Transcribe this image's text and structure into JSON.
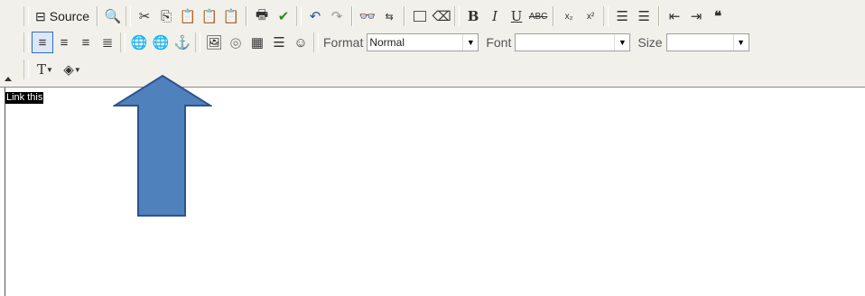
{
  "toolbar": {
    "source_label": "Source",
    "format_label": "Format",
    "format_value": "Normal",
    "font_label": "Font",
    "font_value": "",
    "size_label": "Size",
    "size_value": "",
    "bold": "B",
    "italic": "I",
    "underline": "U",
    "strike": "ABC",
    "subscript": "x₂",
    "superscript": "x²"
  },
  "editor": {
    "selected_text": "Link this"
  },
  "colors": {
    "toolbar_bg": "#f1f0ea",
    "arrow_fill": "#4f81bd",
    "arrow_stroke": "#2f528f",
    "active_button_border": "#316ac5"
  }
}
